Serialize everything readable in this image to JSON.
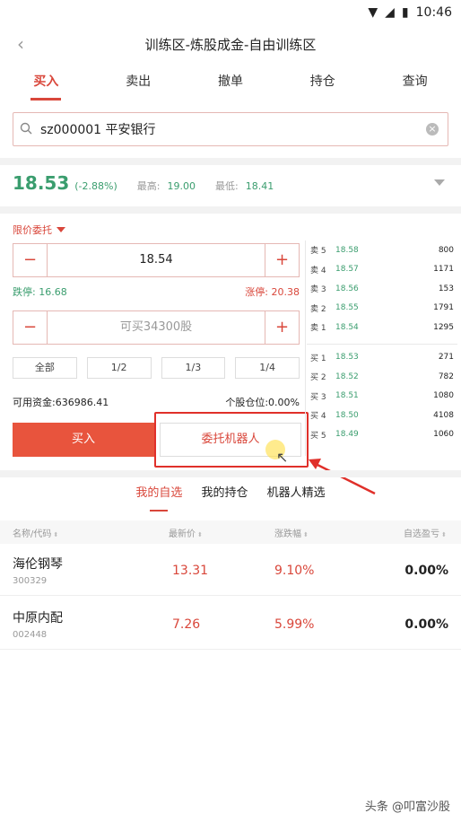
{
  "status": {
    "time": "10:46"
  },
  "header": {
    "title": "训练区-炼股成金-自由训练区"
  },
  "tabs": [
    {
      "label": "买入",
      "active": true
    },
    {
      "label": "卖出"
    },
    {
      "label": "撤单"
    },
    {
      "label": "持仓"
    },
    {
      "label": "查询"
    }
  ],
  "search": {
    "value": "sz000001 平安银行"
  },
  "quote": {
    "price": "18.53",
    "change": "(-2.88%)",
    "high_label": "最高:",
    "high": "19.00",
    "low_label": "最低:",
    "low": "18.41"
  },
  "order": {
    "type": "限价委托",
    "price_value": "18.54",
    "limit_down": "跌停: 16.68",
    "limit_up": "涨停: 20.38",
    "qty_placeholder": "可买34300股",
    "minus": "−",
    "plus": "+",
    "ratios": [
      "全部",
      "1/2",
      "1/3",
      "1/4"
    ],
    "funds": "可用资金:636986.41",
    "position_ratio": "个股仓位:0.00%",
    "buy_label": "买入",
    "robot_label": "委托机器人"
  },
  "book": {
    "asks": [
      {
        "label": "卖 5",
        "price": "18.58",
        "vol": "800"
      },
      {
        "label": "卖 4",
        "price": "18.57",
        "vol": "1171"
      },
      {
        "label": "卖 3",
        "price": "18.56",
        "vol": "153"
      },
      {
        "label": "卖 2",
        "price": "18.55",
        "vol": "1791"
      },
      {
        "label": "卖 1",
        "price": "18.54",
        "vol": "1295"
      }
    ],
    "bids": [
      {
        "label": "买 1",
        "price": "18.53",
        "vol": "271"
      },
      {
        "label": "买 2",
        "price": "18.52",
        "vol": "782"
      },
      {
        "label": "买 3",
        "price": "18.51",
        "vol": "1080"
      },
      {
        "label": "买 4",
        "price": "18.50",
        "vol": "4108"
      },
      {
        "label": "买 5",
        "price": "18.49",
        "vol": "1060"
      }
    ]
  },
  "subtabs": [
    {
      "label": "我的自选",
      "active": true
    },
    {
      "label": "我的持仓"
    },
    {
      "label": "机器人精选"
    }
  ],
  "table": {
    "headers": [
      "名称/代码",
      "最新价",
      "涨跌幅",
      "自选盈亏"
    ],
    "rows": [
      {
        "name": "海伦钢琴",
        "code": "300329",
        "last": "13.31",
        "change": "9.10%",
        "pl": "0.00%"
      },
      {
        "name": "中原内配",
        "code": "002448",
        "last": "7.26",
        "change": "5.99%",
        "pl": "0.00%"
      }
    ]
  },
  "watermark": "头条 @叩富沙股",
  "colors": {
    "accent": "#d9473b",
    "down": "#3a9d6e",
    "buy_button": "#e8543d"
  }
}
